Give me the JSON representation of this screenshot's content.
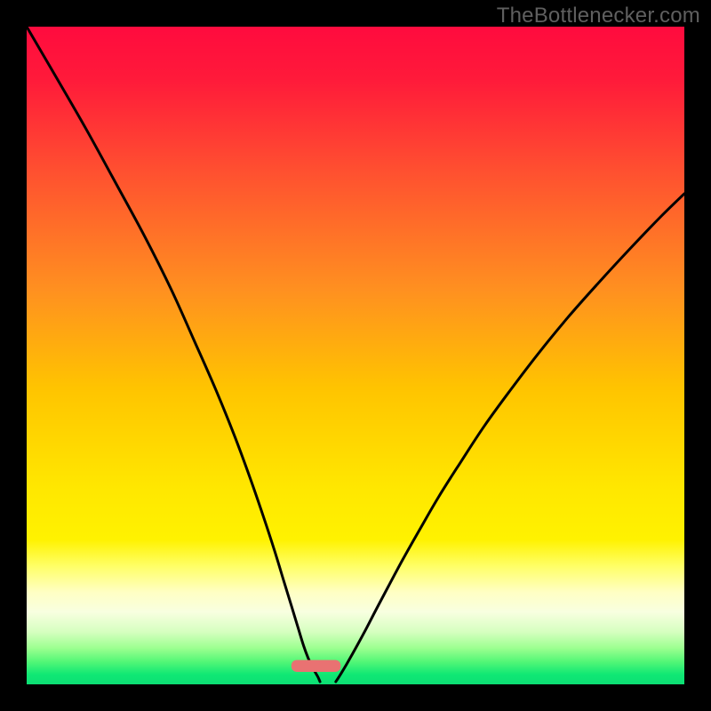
{
  "watermark": "TheBottlenecker.com",
  "chart_data": {
    "type": "line",
    "title": "",
    "xlabel": "",
    "ylabel": "",
    "xlim": [
      0,
      100
    ],
    "ylim": [
      0,
      100
    ],
    "x_at_min": 44,
    "gradient_stops": [
      {
        "offset": 0,
        "color": "#ff0b3e"
      },
      {
        "offset": 0.08,
        "color": "#ff1a3a"
      },
      {
        "offset": 0.22,
        "color": "#ff5030"
      },
      {
        "offset": 0.4,
        "color": "#ff9020"
      },
      {
        "offset": 0.55,
        "color": "#ffc400"
      },
      {
        "offset": 0.7,
        "color": "#ffe700"
      },
      {
        "offset": 0.78,
        "color": "#fff200"
      },
      {
        "offset": 0.82,
        "color": "#ffff66"
      },
      {
        "offset": 0.86,
        "color": "#ffffc4"
      },
      {
        "offset": 0.89,
        "color": "#f8ffe0"
      },
      {
        "offset": 0.92,
        "color": "#d6ffc0"
      },
      {
        "offset": 0.945,
        "color": "#9cff90"
      },
      {
        "offset": 0.965,
        "color": "#55f777"
      },
      {
        "offset": 0.985,
        "color": "#10e874"
      },
      {
        "offset": 1.0,
        "color": "#0cde74"
      }
    ],
    "marker": {
      "x_frac": 0.44,
      "y_frac": 0.972,
      "width_frac": 0.075,
      "height_frac": 0.018,
      "fill": "#e97272",
      "rx": 6
    },
    "series": [
      {
        "name": "left-curve",
        "points": [
          {
            "x": 0.0,
            "y": 100.0
          },
          {
            "x": 4.5,
            "y": 92.3
          },
          {
            "x": 9.0,
            "y": 84.5
          },
          {
            "x": 13.5,
            "y": 76.3
          },
          {
            "x": 18.0,
            "y": 68.0
          },
          {
            "x": 22.0,
            "y": 60.0
          },
          {
            "x": 25.5,
            "y": 52.2
          },
          {
            "x": 28.8,
            "y": 44.7
          },
          {
            "x": 31.6,
            "y": 37.8
          },
          {
            "x": 34.0,
            "y": 31.3
          },
          {
            "x": 36.0,
            "y": 25.5
          },
          {
            "x": 37.7,
            "y": 20.3
          },
          {
            "x": 39.1,
            "y": 15.7
          },
          {
            "x": 40.3,
            "y": 11.8
          },
          {
            "x": 41.3,
            "y": 8.5
          },
          {
            "x": 42.1,
            "y": 5.9
          },
          {
            "x": 42.8,
            "y": 4.0
          },
          {
            "x": 43.4,
            "y": 2.7
          },
          {
            "x": 43.9,
            "y": 1.8
          },
          {
            "x": 44.3,
            "y": 1.1
          },
          {
            "x": 44.6,
            "y": 0.4
          }
        ]
      },
      {
        "name": "right-curve",
        "points": [
          {
            "x": 47.0,
            "y": 0.4
          },
          {
            "x": 47.4,
            "y": 1.0
          },
          {
            "x": 47.9,
            "y": 1.8
          },
          {
            "x": 48.5,
            "y": 2.8
          },
          {
            "x": 49.3,
            "y": 4.2
          },
          {
            "x": 50.3,
            "y": 6.0
          },
          {
            "x": 51.6,
            "y": 8.4
          },
          {
            "x": 53.1,
            "y": 11.3
          },
          {
            "x": 55.0,
            "y": 14.9
          },
          {
            "x": 57.2,
            "y": 19.0
          },
          {
            "x": 59.8,
            "y": 23.6
          },
          {
            "x": 62.7,
            "y": 28.6
          },
          {
            "x": 66.0,
            "y": 33.8
          },
          {
            "x": 69.6,
            "y": 39.3
          },
          {
            "x": 73.6,
            "y": 44.8
          },
          {
            "x": 77.8,
            "y": 50.3
          },
          {
            "x": 82.3,
            "y": 55.8
          },
          {
            "x": 87.0,
            "y": 61.1
          },
          {
            "x": 91.8,
            "y": 66.3
          },
          {
            "x": 96.6,
            "y": 71.3
          },
          {
            "x": 100.0,
            "y": 74.6
          }
        ]
      }
    ],
    "curve_stroke": "#000000",
    "curve_width": 3
  }
}
